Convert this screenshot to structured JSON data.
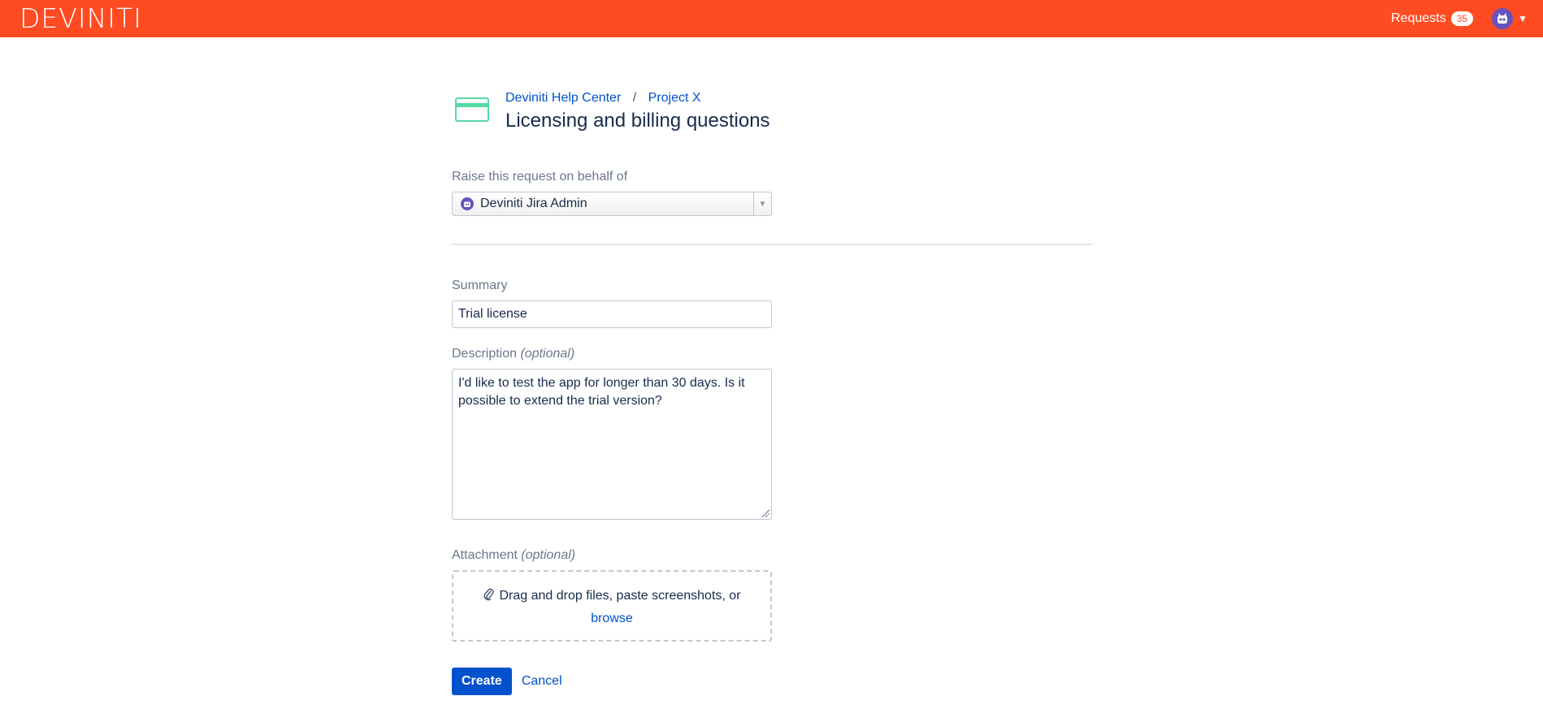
{
  "header": {
    "logo_text": "DEVINITI",
    "requests_label": "Requests",
    "requests_count": "35",
    "brand_color": "#ff4b22"
  },
  "breadcrumb": {
    "items": [
      "Deviniti Help Center",
      "Project X"
    ],
    "separator": "/"
  },
  "page": {
    "title": "Licensing and billing questions"
  },
  "form": {
    "behalf_label": "Raise this request on behalf of",
    "behalf_value": "Deviniti Jira Admin",
    "summary_label": "Summary",
    "summary_value": "Trial license",
    "description_label": "Description",
    "description_optional": "(optional)",
    "description_value": "I'd like to test the app for longer than 30 days. Is it possible to extend the trial version?",
    "attachment_label": "Attachment",
    "attachment_optional": "(optional)",
    "dropzone_text": "Drag and drop files, paste screenshots, or",
    "browse_label": "browse",
    "create_label": "Create",
    "cancel_label": "Cancel"
  },
  "icons": {
    "portal": "credit-card-icon",
    "attachment": "paperclip-icon",
    "avatar": "robot-avatar-icon"
  }
}
